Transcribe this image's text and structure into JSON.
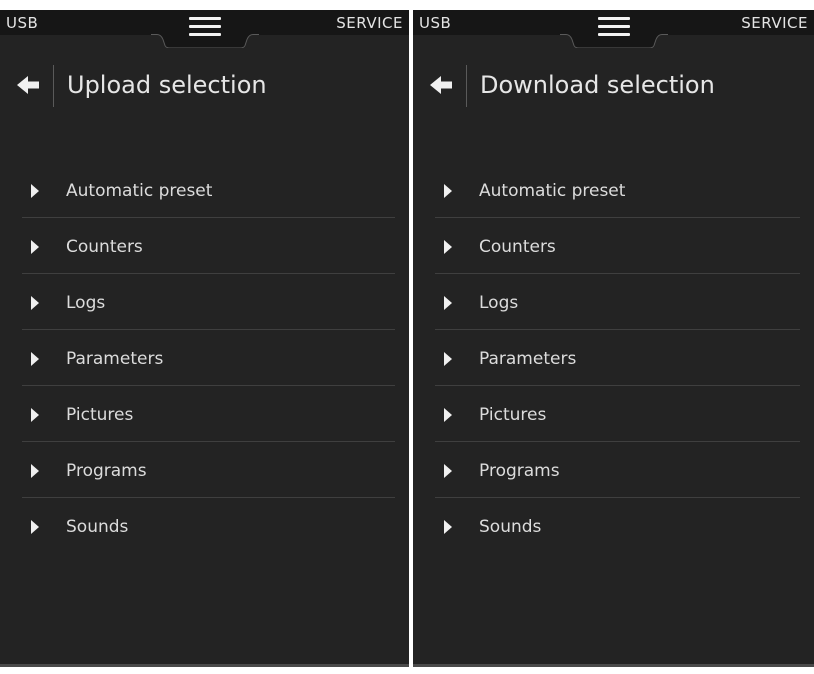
{
  "panels": [
    {
      "top_left": "USB",
      "top_right": "SERVICE",
      "title": "Upload selection",
      "items": [
        {
          "label": "Automatic preset"
        },
        {
          "label": "Counters"
        },
        {
          "label": "Logs"
        },
        {
          "label": "Parameters"
        },
        {
          "label": "Pictures"
        },
        {
          "label": "Programs"
        },
        {
          "label": "Sounds"
        }
      ]
    },
    {
      "top_left": "USB",
      "top_right": "SERVICE",
      "title": "Download selection",
      "items": [
        {
          "label": "Automatic preset"
        },
        {
          "label": "Counters"
        },
        {
          "label": "Logs"
        },
        {
          "label": "Parameters"
        },
        {
          "label": "Pictures"
        },
        {
          "label": "Programs"
        },
        {
          "label": "Sounds"
        }
      ]
    }
  ],
  "icons": {
    "menu": "hamburger-menu-icon",
    "back": "arrow-left-icon",
    "item": "triangle-right-icon"
  },
  "colors": {
    "panel_background": "#232323",
    "top_bar": "#161616",
    "text": "#dcdcdc",
    "accent": "#f0f0f0"
  }
}
